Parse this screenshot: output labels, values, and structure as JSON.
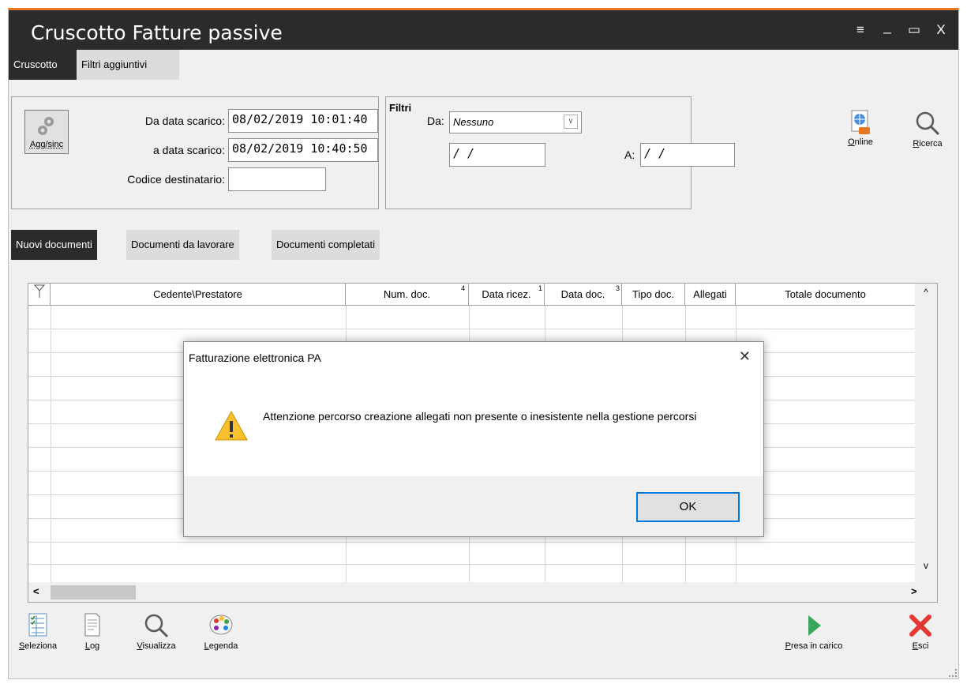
{
  "window": {
    "title": "Cruscotto Fatture passive",
    "accent_color": "#e87722",
    "controls": {
      "menu": "≡",
      "minimize": "_",
      "maximize": "▭",
      "close": "X"
    }
  },
  "top_tabs": [
    "Cruscotto",
    "Filtri aggiuntivi"
  ],
  "scarico_panel": {
    "sync_button_label": "Agg/sinc",
    "da_label": "Da data scarico:",
    "da_value": "08/02/2019 10:01:40",
    "a_label": "a data scarico:",
    "a_value": "08/02/2019 10:40:50",
    "codice_label": "Codice destinatario:",
    "codice_value": ""
  },
  "filtri_panel": {
    "title": "Filtri",
    "da_label": "Da:",
    "da_select": "Nessuno",
    "date_from": "/ /",
    "a_label": "A:",
    "date_to": "/ /"
  },
  "right_tools": [
    {
      "label": "Online",
      "icon": "globe-icon"
    },
    {
      "label": "Ricerca",
      "icon": "search-icon"
    }
  ],
  "doc_tabs": [
    "Nuovi documenti",
    "Documenti da lavorare",
    "Documenti completati"
  ],
  "grid": {
    "columns": [
      {
        "label": "Cedente\\Prestatore",
        "sort": ""
      },
      {
        "label": "Num. doc.",
        "sort": "4"
      },
      {
        "label": "Data ricez.",
        "sort": "1"
      },
      {
        "label": "Data doc.",
        "sort": "3"
      },
      {
        "label": "Tipo doc.",
        "sort": ""
      },
      {
        "label": "Allegati",
        "sort": ""
      },
      {
        "label": "Totale documento",
        "sort": ""
      }
    ],
    "scroll_up": "^",
    "scroll_down": "v",
    "scroll_left": "<",
    "scroll_right": ">"
  },
  "dialog": {
    "title": "Fatturazione elettronica PA",
    "message": "Attenzione percorso creazione allegati non presente o inesistente nella gestione percorsi",
    "ok_label": "OK",
    "close_glyph": "✕",
    "icon": "warning-icon"
  },
  "bottom_tools": [
    {
      "label": "Seleziona",
      "icon": "select-icon"
    },
    {
      "label": "Log",
      "icon": "log-icon"
    },
    {
      "label": "Visualizza",
      "icon": "search-icon"
    },
    {
      "label": "Legenda",
      "icon": "palette-icon"
    },
    {
      "label": "Presa in carico",
      "icon": "play-icon"
    },
    {
      "label": "Esci",
      "icon": "exit-icon"
    }
  ]
}
